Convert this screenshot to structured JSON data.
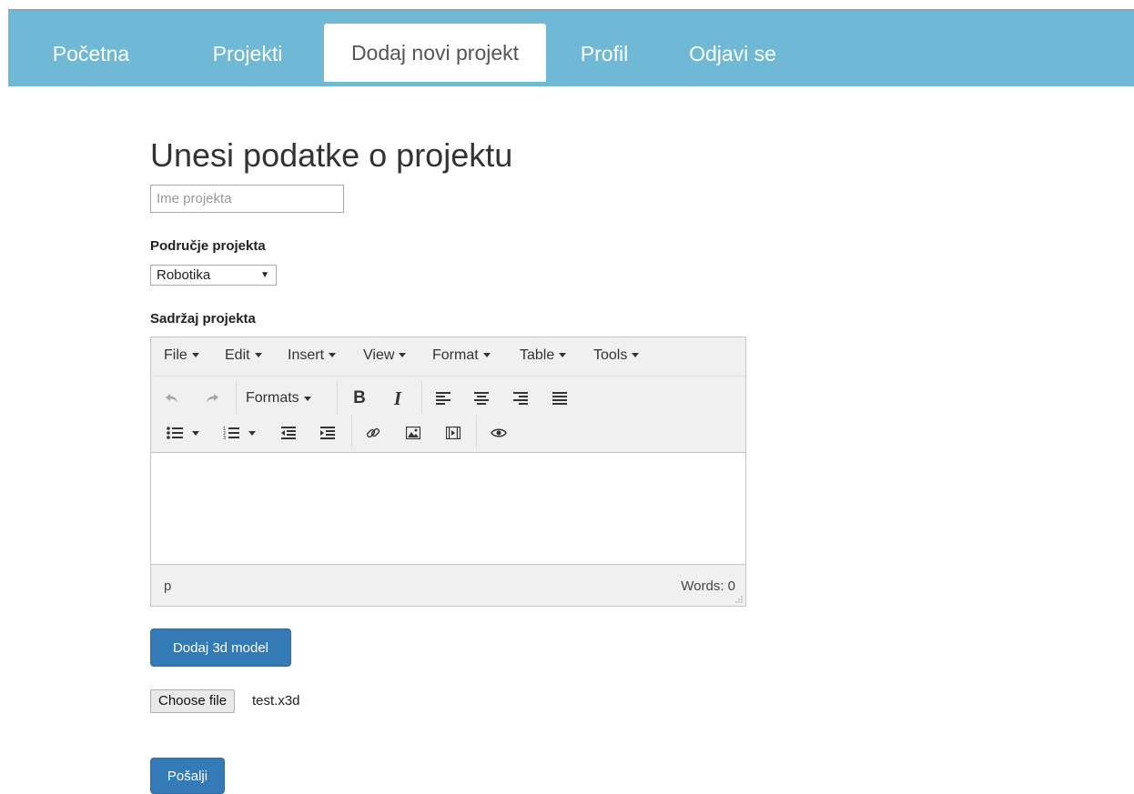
{
  "nav": {
    "items": [
      {
        "label": "Početna"
      },
      {
        "label": "Projekti"
      },
      {
        "label": "Dodaj novi projekt",
        "active": true
      },
      {
        "label": "Profil"
      },
      {
        "label": "Odjavi se"
      }
    ]
  },
  "form": {
    "title": "Unesi podatke o projektu",
    "name_placeholder": "Ime projekta",
    "name_value": "",
    "area_label": "Područje projekta",
    "area_selected": "Robotika",
    "content_label": "Sadržaj projekta"
  },
  "editor": {
    "menus": [
      "File",
      "Edit",
      "Insert",
      "View",
      "Format",
      "Table",
      "Tools"
    ],
    "formats_label": "Formats",
    "bold_label": "B",
    "italic_label": "I",
    "status_path": "p",
    "word_count": "Words: 0",
    "icons": [
      "undo-icon",
      "redo-icon",
      "align-left-icon",
      "align-center-icon",
      "align-right-icon",
      "align-justify-icon",
      "bullet-list-icon",
      "numbered-list-icon",
      "outdent-icon",
      "indent-icon",
      "link-icon",
      "image-icon",
      "media-icon",
      "preview-icon"
    ]
  },
  "actions": {
    "add_model_label": "Dodaj 3d model",
    "choose_file_label": "Choose file",
    "file_name": "test.x3d",
    "submit_label": "Pošalji"
  },
  "colors": {
    "navbar": "#6fb9d6",
    "primary": "#337ab7"
  }
}
